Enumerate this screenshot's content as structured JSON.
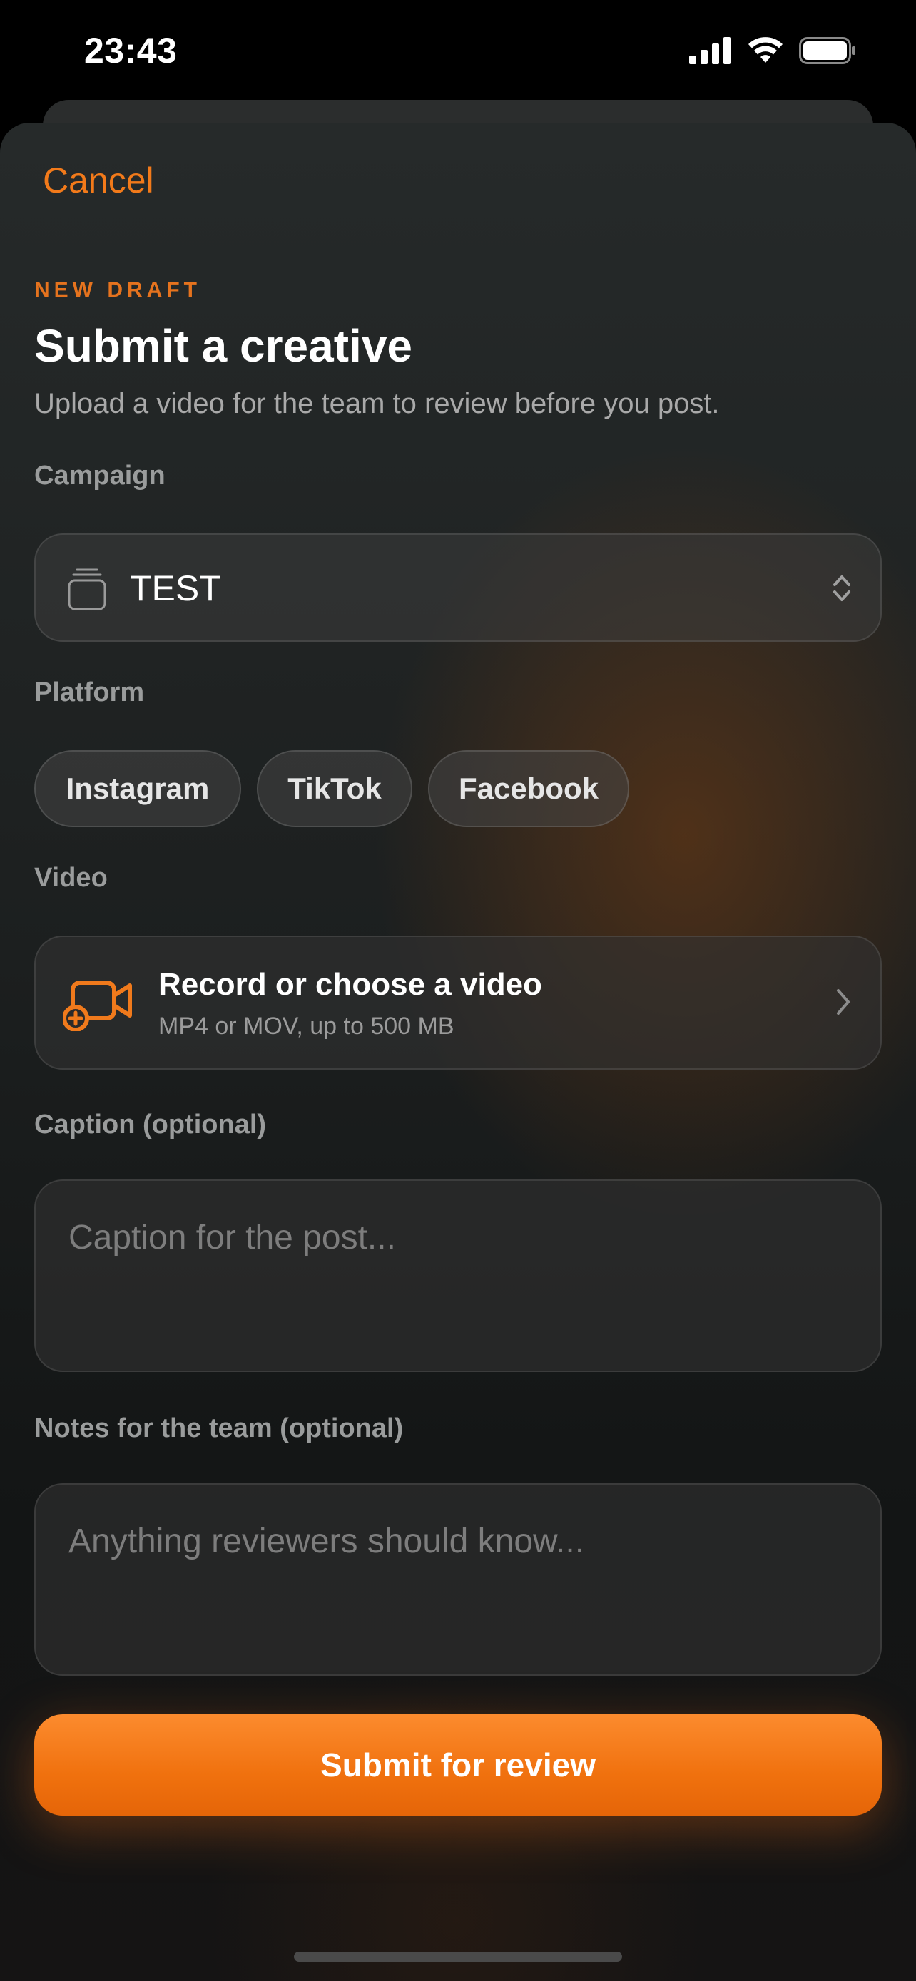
{
  "status_bar": {
    "time": "23:43"
  },
  "header": {
    "cancel_label": "Cancel"
  },
  "hero": {
    "eyebrow": "NEW DRAFT",
    "title": "Submit a creative",
    "subtitle": "Upload a video for the team to review before you post."
  },
  "campaign": {
    "label": "Campaign",
    "value": "TEST",
    "icon": "stack-icon"
  },
  "platform": {
    "label": "Platform",
    "options": [
      "Instagram",
      "TikTok",
      "Facebook"
    ]
  },
  "video": {
    "label": "Video",
    "title": "Record or choose a video",
    "subtitle": "MP4 or MOV, up to 500 MB",
    "icon": "video-plus-icon"
  },
  "caption": {
    "label": "Caption (optional)",
    "placeholder": "Caption for the post..."
  },
  "notes": {
    "label": "Notes for the team (optional)",
    "placeholder": "Anything reviewers should know..."
  },
  "submit": {
    "label": "Submit for review"
  },
  "colors": {
    "accent": "#f27a1a",
    "button_top": "#fc8b2e",
    "button_bottom": "#e56508"
  }
}
